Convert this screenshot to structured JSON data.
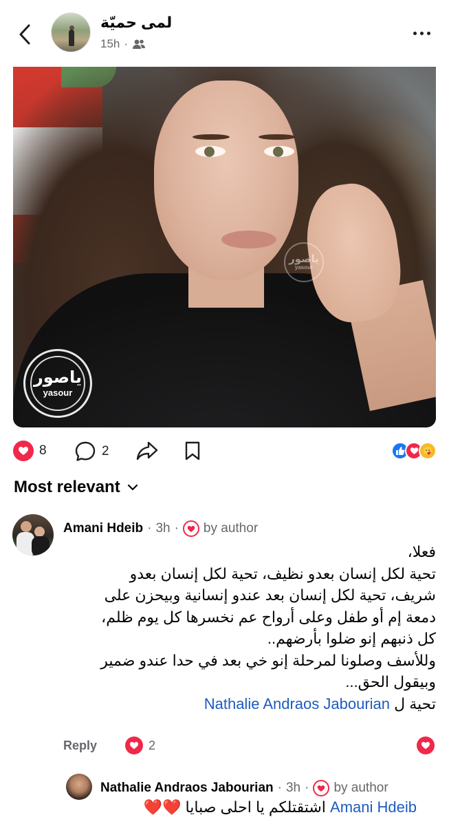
{
  "header": {
    "author_name": "لمى حميّة",
    "time": "15h",
    "separator": "·",
    "audience_icon": "friends-icon"
  },
  "post": {
    "image_watermark_ar": "ياصور",
    "image_watermark_en": "yasour"
  },
  "actions": {
    "like_count": "8",
    "comment_count": "2",
    "reactions": [
      "like",
      "love",
      "care"
    ]
  },
  "comments_sort": {
    "label": "Most relevant"
  },
  "comments": [
    {
      "author": "Amani Hdeib",
      "time": "3h",
      "separator": "·",
      "badge": "by author",
      "lines": [
        "فعلا،",
        "تحية لكل إنسان بعدو نظيف، تحية لكل إنسان بعدو",
        "شريف، تحية لكل إنسان بعد عندو إنسانية وبيحزن على",
        "دمعة إم أو طفل وعلى أرواح عم نخسرها كل يوم ظلم،",
        "كل ذنبهم إنو ضلوا بأرضهم..",
        "وللأسف وصلونا لمرحلة إنو خي بعد في حدا عندو ضمير",
        "وبيقول الحق..."
      ],
      "last_line_prefix": "تحية ل",
      "mention": "Nathalie Andraos Jabourian",
      "reply_label": "Reply",
      "reaction_count": "2"
    },
    {
      "author": "Nathalie Andraos Jabourian",
      "time": "3h",
      "separator": "·",
      "badge": "by author",
      "mention": "Amani Hdeib",
      "text": " اشتقتلكم يا احلى صبايا ",
      "emoji": "❤️❤️"
    }
  ]
}
